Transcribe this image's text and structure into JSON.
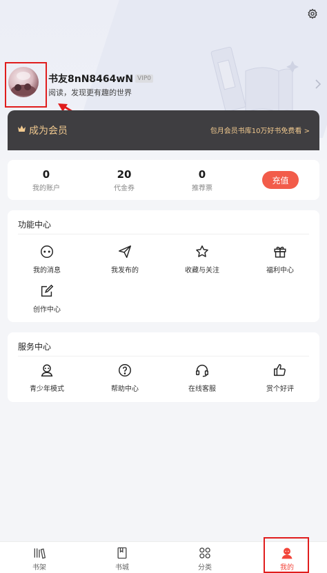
{
  "header": {
    "settings_icon": "gear-icon",
    "username": "书友8nN8464wN",
    "vip_level": "VIP0",
    "signature": "阅读，发现更有趣的世界"
  },
  "vip_banner": {
    "title": "成为会员",
    "promo": "包月会员书库10万好书免费看 >",
    "accent_color": "#f1c98f"
  },
  "stats": [
    {
      "value": "0",
      "label": "我的账户"
    },
    {
      "value": "20",
      "label": "代金券"
    },
    {
      "value": "0",
      "label": "推荐票"
    }
  ],
  "recharge_label": "充值",
  "function_center": {
    "title": "功能中心",
    "items": [
      {
        "label": "我的消息",
        "icon": "message-icon"
      },
      {
        "label": "我发布的",
        "icon": "send-icon"
      },
      {
        "label": "收藏与关注",
        "icon": "star-icon"
      },
      {
        "label": "福利中心",
        "icon": "gift-icon"
      },
      {
        "label": "创作中心",
        "icon": "edit-icon"
      }
    ]
  },
  "service_center": {
    "title": "服务中心",
    "items": [
      {
        "label": "青少年模式",
        "icon": "youth-mode-icon"
      },
      {
        "label": "帮助中心",
        "icon": "help-icon"
      },
      {
        "label": "在线客服",
        "icon": "headset-icon"
      },
      {
        "label": "赏个好评",
        "icon": "thumbs-up-icon"
      }
    ]
  },
  "tabbar": {
    "active": "我的",
    "tabs": [
      {
        "label": "书架",
        "icon": "bookshelf-icon"
      },
      {
        "label": "书城",
        "icon": "bookstore-icon"
      },
      {
        "label": "分类",
        "icon": "category-icon"
      },
      {
        "label": "我的",
        "icon": "profile-icon"
      }
    ]
  },
  "colors": {
    "accent": "#f25c4a",
    "annotation": "#e01c1c"
  }
}
